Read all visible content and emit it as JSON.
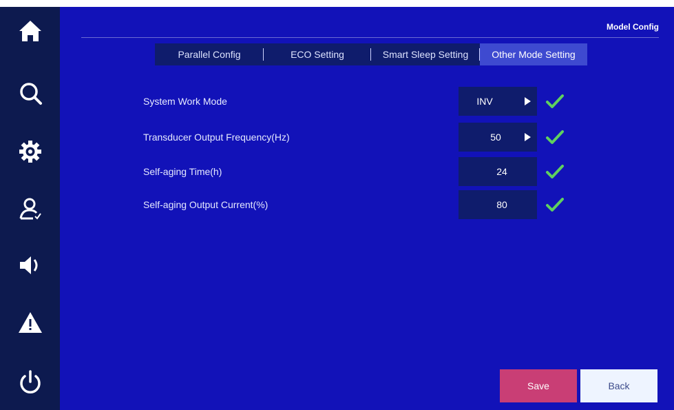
{
  "header": {
    "title": "Model Config"
  },
  "sidebar": {
    "items": [
      {
        "icon": "home-icon"
      },
      {
        "icon": "search-icon"
      },
      {
        "icon": "gear-icon"
      },
      {
        "icon": "user-icon"
      },
      {
        "icon": "speaker-icon"
      },
      {
        "icon": "warning-icon"
      },
      {
        "icon": "power-icon"
      }
    ]
  },
  "tabs": [
    {
      "label": "Parallel Config",
      "active": false
    },
    {
      "label": "ECO Setting",
      "active": false
    },
    {
      "label": "Smart Sleep Setting",
      "active": false
    },
    {
      "label": "Other Mode Setting",
      "active": true
    }
  ],
  "settings": [
    {
      "label": "System Work Mode",
      "value": "INV",
      "has_dropdown": true,
      "confirmed": true
    },
    {
      "label": "Transducer Output Frequency(Hz)",
      "value": "50",
      "has_dropdown": true,
      "confirmed": true
    },
    {
      "label": "Self-aging Time(h)",
      "value": "24",
      "has_dropdown": false,
      "confirmed": true
    },
    {
      "label": "Self-aging Output Current(%)",
      "value": "80",
      "has_dropdown": false,
      "confirmed": true
    }
  ],
  "buttons": {
    "save": "Save",
    "back": "Back"
  },
  "colors": {
    "background": "#1212b8",
    "sidebar": "#0d1a4f",
    "active_tab": "#3e4ad0",
    "check": "#5fd05f",
    "save_button": "#c93e75",
    "back_button": "#eef4ff"
  }
}
